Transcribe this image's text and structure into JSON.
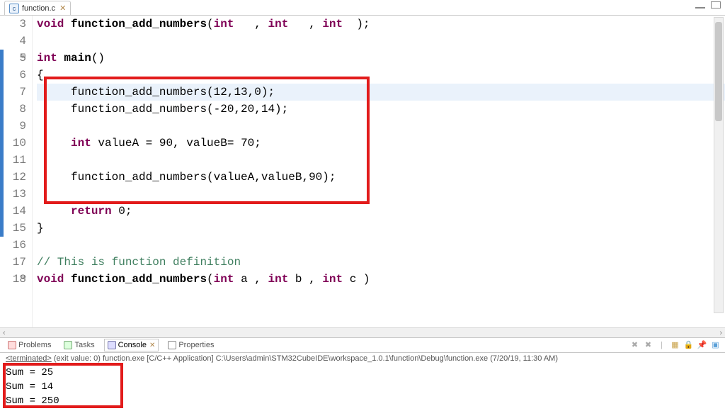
{
  "editor": {
    "tab_filename": "function.c",
    "lines": [
      {
        "n": 3,
        "bluebar": false,
        "fold": "",
        "hl": false
      },
      {
        "n": 4,
        "bluebar": false,
        "fold": "",
        "hl": false
      },
      {
        "n": 5,
        "bluebar": true,
        "fold": "⊖",
        "hl": false
      },
      {
        "n": 6,
        "bluebar": true,
        "fold": "",
        "hl": false
      },
      {
        "n": 7,
        "bluebar": true,
        "fold": "",
        "hl": true
      },
      {
        "n": 8,
        "bluebar": true,
        "fold": "",
        "hl": false
      },
      {
        "n": 9,
        "bluebar": true,
        "fold": "",
        "hl": false
      },
      {
        "n": 10,
        "bluebar": true,
        "fold": "",
        "hl": false
      },
      {
        "n": 11,
        "bluebar": true,
        "fold": "",
        "hl": false
      },
      {
        "n": 12,
        "bluebar": true,
        "fold": "",
        "hl": false
      },
      {
        "n": 13,
        "bluebar": true,
        "fold": "",
        "hl": false
      },
      {
        "n": 14,
        "bluebar": true,
        "fold": "",
        "hl": false
      },
      {
        "n": 15,
        "bluebar": true,
        "fold": "",
        "hl": false
      },
      {
        "n": 16,
        "bluebar": false,
        "fold": "",
        "hl": false
      },
      {
        "n": 17,
        "bluebar": false,
        "fold": "",
        "hl": false
      },
      {
        "n": 18,
        "bluebar": false,
        "fold": "⊖",
        "hl": false
      }
    ],
    "code": {
      "l3": {
        "kw1": "void",
        "fn": "function_add_numbers",
        "sig_open": "(",
        "kw2": "int",
        "c1": "   , ",
        "kw3": "int",
        "c2": "   , ",
        "kw4": "int",
        "sig_close": "  );"
      },
      "l4": "",
      "l5": {
        "kw1": "int",
        "fn": "main",
        "tail": "()"
      },
      "l6": "{",
      "l7": "     function_add_numbers(12,13,0);",
      "l8": "     function_add_numbers(-20,20,14);",
      "l9": "",
      "l10": {
        "pre": "     ",
        "kw": "int",
        "rest": " valueA = 90, valueB= 70;"
      },
      "l11": "",
      "l12": "     function_add_numbers(valueA,valueB,90);",
      "l13": "",
      "l14": {
        "pre": "     ",
        "kw": "return",
        "rest": " 0;"
      },
      "l15": "}",
      "l16": "",
      "l17": "// This is function definition",
      "l18": {
        "kw1": "void",
        "fn": "function_add_numbers",
        "sig_open": "(",
        "kw2": "int",
        "a": " a , ",
        "kw3": "int",
        "b": " b , ",
        "kw4": "int",
        "c": " c )"
      }
    }
  },
  "panel": {
    "tabs": {
      "problems": "Problems",
      "tasks": "Tasks",
      "console": "Console",
      "properties": "Properties"
    },
    "status": {
      "terminated": "<terminated>",
      "exit": " (exit value: 0) ",
      "app": "function.exe [C/C++ Application] C:\\Users\\admin\\STM32CubeIDE\\workspace_1.0.1\\function\\Debug\\function.exe (7/20/19, 11:30 AM)"
    },
    "console_lines": [
      "Sum = 25",
      "Sum = 14",
      "Sum = 250"
    ]
  }
}
